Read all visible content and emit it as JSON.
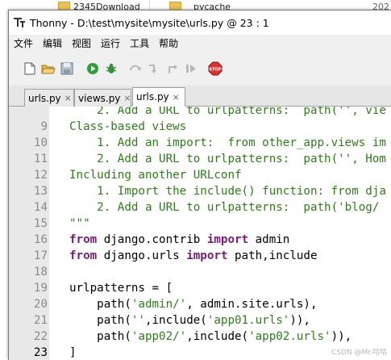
{
  "background": {
    "items": [
      {
        "label": "2345Download"
      },
      {
        "label": "__pycache__"
      },
      {
        "label": "202"
      }
    ]
  },
  "window": {
    "title": "Thonny  -  D:\\test\\mysite\\mysite\\urls.py  @  23 : 1"
  },
  "menu": [
    "文件",
    "编辑",
    "视图",
    "运行",
    "工具",
    "帮助"
  ],
  "toolbar": {
    "buttons": [
      "new-file",
      "open-file",
      "save-file",
      "run",
      "debug",
      "step-over",
      "step-into",
      "step-out",
      "resume",
      "stop"
    ],
    "stop_label": "STOP"
  },
  "tabs": [
    {
      "label": "urls.py",
      "close": "×",
      "active": false
    },
    {
      "label": "views.py",
      "close": "×",
      "active": false
    },
    {
      "label": "urls.py",
      "close": "×",
      "active": true
    }
  ],
  "editor": {
    "current_line": 23,
    "lines": [
      {
        "num": "",
        "tokens": [
          {
            "t": "    2. Add a URL to urlpatterns:  path('', vie",
            "c": "str"
          }
        ]
      },
      {
        "num": "9",
        "tokens": [
          {
            "t": "Class-based views",
            "c": "str"
          }
        ]
      },
      {
        "num": "10",
        "tokens": [
          {
            "t": "    1. Add an import:  from other_app.views im",
            "c": "str"
          }
        ]
      },
      {
        "num": "11",
        "tokens": [
          {
            "t": "    2. Add a URL to urlpatterns:  path('', Hom",
            "c": "str"
          }
        ]
      },
      {
        "num": "12",
        "tokens": [
          {
            "t": "Including another URLconf",
            "c": "str"
          }
        ]
      },
      {
        "num": "13",
        "tokens": [
          {
            "t": "    1. Import the include() function: from dja",
            "c": "str"
          }
        ]
      },
      {
        "num": "14",
        "tokens": [
          {
            "t": "    2. Add a URL to urlpatterns:  path('blog/",
            "c": "str"
          }
        ]
      },
      {
        "num": "15",
        "tokens": [
          {
            "t": "\"\"\"",
            "c": "str"
          }
        ]
      },
      {
        "num": "16",
        "tokens": [
          {
            "t": "from",
            "c": "kw"
          },
          {
            "t": " django.contrib ",
            "c": "plain"
          },
          {
            "t": "import",
            "c": "kw"
          },
          {
            "t": " admin",
            "c": "plain"
          }
        ]
      },
      {
        "num": "17",
        "tokens": [
          {
            "t": "from",
            "c": "kw"
          },
          {
            "t": " django.urls ",
            "c": "plain"
          },
          {
            "t": "import",
            "c": "kw"
          },
          {
            "t": " path,include",
            "c": "plain"
          }
        ]
      },
      {
        "num": "18",
        "tokens": []
      },
      {
        "num": "19",
        "tokens": [
          {
            "t": "urlpatterns = [",
            "c": "plain"
          }
        ]
      },
      {
        "num": "20",
        "tokens": [
          {
            "t": "    path(",
            "c": "plain"
          },
          {
            "t": "'admin/'",
            "c": "str"
          },
          {
            "t": ", admin.site.urls),",
            "c": "plain"
          }
        ]
      },
      {
        "num": "21",
        "tokens": [
          {
            "t": "    path(",
            "c": "plain"
          },
          {
            "t": "''",
            "c": "str"
          },
          {
            "t": ",include(",
            "c": "plain"
          },
          {
            "t": "'app01.urls'",
            "c": "str"
          },
          {
            "t": ")),",
            "c": "plain"
          }
        ]
      },
      {
        "num": "22",
        "tokens": [
          {
            "t": "    path(",
            "c": "plain"
          },
          {
            "t": "'app02/'",
            "c": "str"
          },
          {
            "t": ",include(",
            "c": "plain"
          },
          {
            "t": "'app02.urls'",
            "c": "str"
          },
          {
            "t": ")),",
            "c": "plain"
          }
        ]
      },
      {
        "num": "23",
        "tokens": [
          {
            "t": "]",
            "c": "plain"
          }
        ]
      }
    ]
  },
  "watermark": "CSDN @Mr.咕咕",
  "colors": {
    "string": "#2e7d1b",
    "keyword": "#7a1a7a",
    "gutter_bg": "#e8e8e8",
    "line_number": "#8a8a8a"
  }
}
